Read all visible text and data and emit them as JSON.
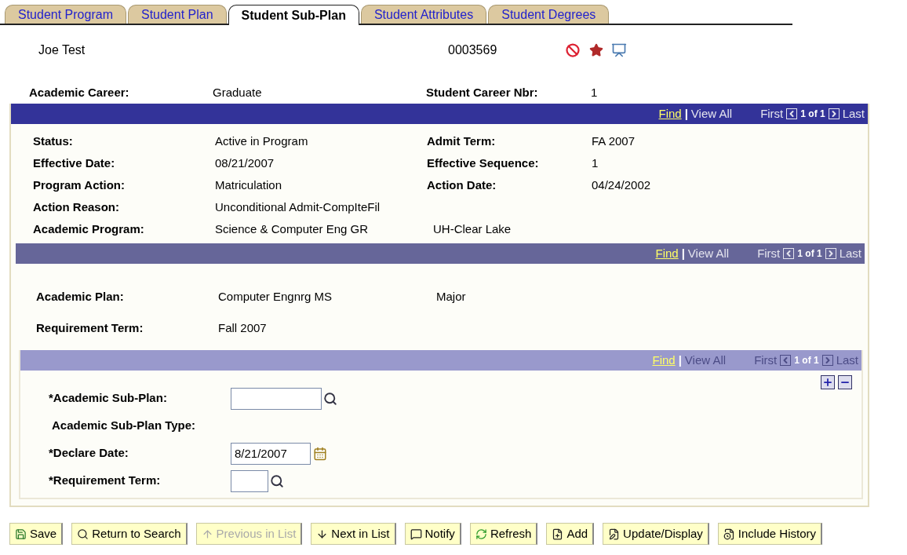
{
  "tabs": [
    {
      "label": "Student Program",
      "selected": false
    },
    {
      "label": "Student Plan",
      "selected": false
    },
    {
      "label": "Student Sub-Plan",
      "selected": true
    },
    {
      "label": "Student Attributes",
      "selected": false
    },
    {
      "label": "Student Degrees",
      "selected": false
    }
  ],
  "header": {
    "name": "Joe Test",
    "id": "0003569"
  },
  "career": {
    "label": "Academic Career:",
    "value": "Graduate",
    "label_2": "Student Career Nbr:",
    "value_2": "1"
  },
  "program": {
    "nav": {
      "find": "Find",
      "separator": "|",
      "view_all": "View All",
      "first": "First",
      "counter": "1 of 1",
      "last": "Last",
      "disabled": false
    },
    "rows": [
      {
        "label": "Status:",
        "value": "Active in Program",
        "label_2": "Admit Term:",
        "value_2": "FA 2007"
      },
      {
        "label": "Effective Date:",
        "value": "08/21/2007",
        "label_2": "Effective Sequence:",
        "value_2": "1"
      },
      {
        "label": "Program Action:",
        "value": "Matriculation",
        "label_2": "Action Date:",
        "value_2": "04/24/2002"
      },
      {
        "label": "Action Reason:",
        "value": "Unconditional Admit-CompIteFil"
      },
      {
        "label": "Academic Program:",
        "value": "Science & Computer Eng GR",
        "note": "UH-Clear Lake"
      }
    ]
  },
  "plan": {
    "nav": {
      "find": "Find",
      "separator": "|",
      "view_all": "View All",
      "first": "First",
      "counter": "1 of 1",
      "last": "Last",
      "disabled": false
    },
    "rows": [
      {
        "label": "Academic Plan:",
        "value": "Computer Engnrg MS",
        "note": "Major"
      },
      {
        "label": "Requirement Term:",
        "value": "Fall 2007"
      }
    ]
  },
  "sub_plan": {
    "nav": {
      "find": "Find",
      "separator": "|",
      "view_all": "View All",
      "first": "First",
      "counter": "1 of 1",
      "last": "Last",
      "disabled": true
    },
    "fields": [
      {
        "kind": "lookup",
        "label": "*Academic Sub-Plan:"
      },
      {
        "kind": "display",
        "label": "Academic Sub-Plan Type:"
      },
      {
        "kind": "date",
        "label": "*Declare Date:",
        "value": "8/21/2007"
      },
      {
        "kind": "short_lookup",
        "label": "*Requirement Term:"
      }
    ]
  },
  "buttons": [
    {
      "label": "Save",
      "disabled": false
    },
    {
      "label": "Return to Search",
      "disabled": false
    },
    {
      "label": "Previous in List",
      "disabled": true
    },
    {
      "label": "Next in List",
      "disabled": false
    },
    {
      "label": "Notify",
      "disabled": false
    },
    {
      "label": "Refresh",
      "disabled": false
    },
    {
      "label": "Add",
      "disabled": false
    },
    {
      "label": "Update/Display",
      "disabled": false
    },
    {
      "label": "Include History",
      "disabled": false
    }
  ]
}
